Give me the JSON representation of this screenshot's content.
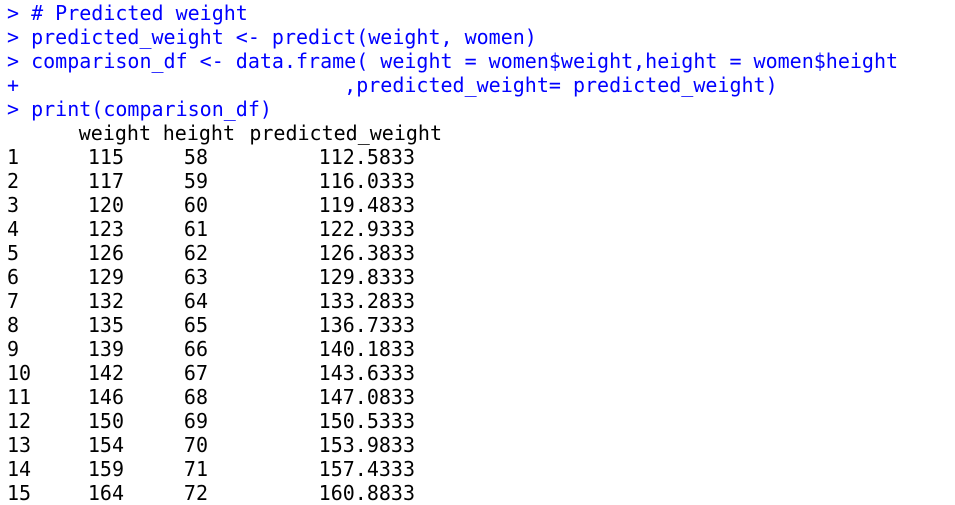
{
  "console": {
    "commands": [
      {
        "prompt": ">",
        "text": "# Predicted weight"
      },
      {
        "prompt": ">",
        "text": "predicted_weight <- predict(weight, women)"
      },
      {
        "prompt": ">",
        "text": "comparison_df <- data.frame( weight = women$weight,height = women$height"
      },
      {
        "prompt": "+",
        "text": "                          ,predicted_weight= predicted_weight)"
      },
      {
        "prompt": ">",
        "text": "print(comparison_df)"
      }
    ],
    "table": {
      "headers": [
        "weight",
        "height",
        "predicted_weight"
      ],
      "rows": [
        [
          "1",
          "115",
          "58",
          "112.5833"
        ],
        [
          "2",
          "117",
          "59",
          "116.0333"
        ],
        [
          "3",
          "120",
          "60",
          "119.4833"
        ],
        [
          "4",
          "123",
          "61",
          "122.9333"
        ],
        [
          "5",
          "126",
          "62",
          "126.3833"
        ],
        [
          "6",
          "129",
          "63",
          "129.8333"
        ],
        [
          "7",
          "132",
          "64",
          "133.2833"
        ],
        [
          "8",
          "135",
          "65",
          "136.7333"
        ],
        [
          "9",
          "139",
          "66",
          "140.1833"
        ],
        [
          "10",
          "142",
          "67",
          "143.6333"
        ],
        [
          "11",
          "146",
          "68",
          "147.0833"
        ],
        [
          "12",
          "150",
          "69",
          "150.5333"
        ],
        [
          "13",
          "154",
          "70",
          "153.9833"
        ],
        [
          "14",
          "159",
          "71",
          "157.4333"
        ],
        [
          "15",
          "164",
          "72",
          "160.8833"
        ]
      ]
    },
    "colors": {
      "command": "#0000ff",
      "output": "#000000",
      "background": "#ffffff"
    }
  }
}
